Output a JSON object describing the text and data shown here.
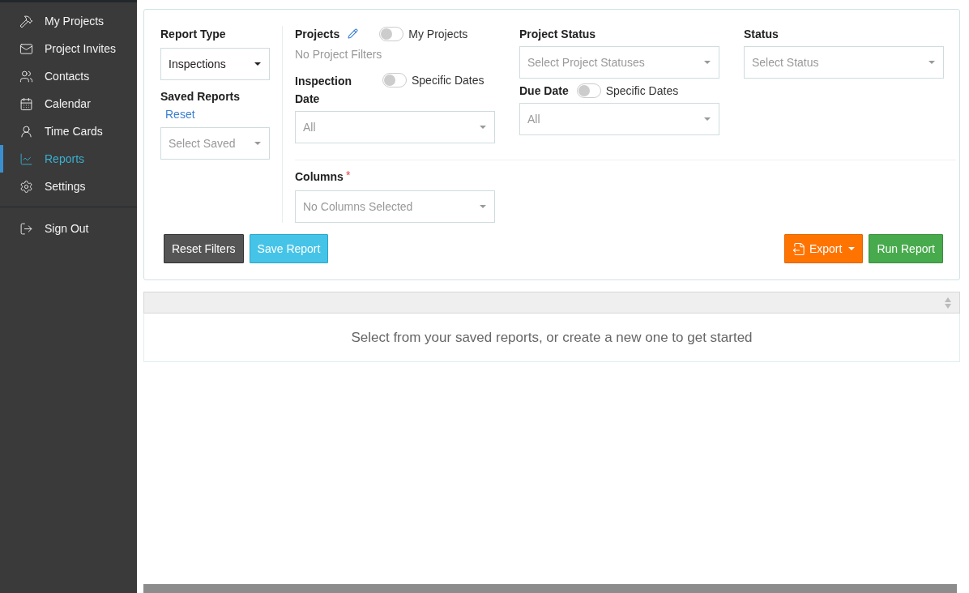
{
  "sidebar": {
    "items": [
      {
        "label": "My Projects",
        "selected": false
      },
      {
        "label": "Project Invites",
        "selected": false
      },
      {
        "label": "Contacts",
        "selected": false
      },
      {
        "label": "Calendar",
        "selected": false
      },
      {
        "label": "Time Cards",
        "selected": false
      },
      {
        "label": "Reports",
        "selected": true
      },
      {
        "label": "Settings",
        "selected": false
      }
    ],
    "footer_items": [
      {
        "label": "Sign Out",
        "selected": false
      }
    ]
  },
  "filters": {
    "report_type": {
      "label": "Report Type",
      "value": "Inspections"
    },
    "saved_reports": {
      "label": "Saved Reports",
      "reset_link": "Reset",
      "placeholder": "Select Saved"
    },
    "projects": {
      "label": "Projects",
      "toggle": {
        "label": "My Projects",
        "on": false
      },
      "empty_text": "No Project Filters"
    },
    "inspection_date": {
      "label": "Inspection Date",
      "toggle": {
        "label": "Specific Dates",
        "on": false
      },
      "placeholder": "All"
    },
    "project_status": {
      "label": "Project Status",
      "placeholder": "Select Project Statuses"
    },
    "due_date": {
      "label": "Due Date",
      "toggle": {
        "label": "Specific Dates",
        "on": false
      },
      "placeholder": "All"
    },
    "status": {
      "label": "Status",
      "placeholder": "Select Status"
    },
    "columns": {
      "label": "Columns",
      "required": true,
      "required_mark": "*",
      "placeholder": "No Columns Selected"
    }
  },
  "buttons": {
    "left": [
      "Reset Filters",
      "Save Report"
    ],
    "export": "Export",
    "run": "Run Report"
  },
  "table": {
    "empty_message": "Select from your saved reports, or create a new one to get started"
  }
}
